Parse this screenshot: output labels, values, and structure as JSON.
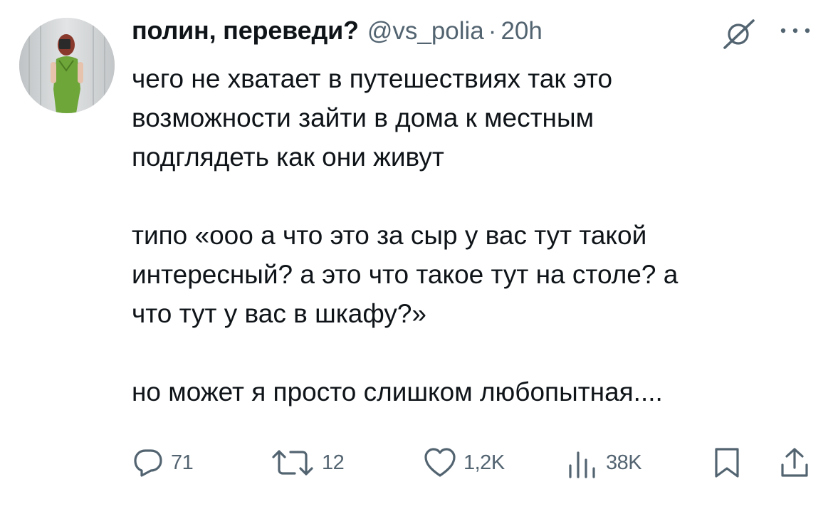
{
  "tweet": {
    "display_name": "полин, переведи?",
    "handle": "@vs_polia",
    "separator": "·",
    "time": "20h",
    "text": "чего не хватает в путешествиях так это\nвозможности зайти в дома к местным\nподглядеть как они живут\n\nтипо «ооо а что это за сыр у вас тут такой\nинтересный? а это что такое тут на столе? а\nчто тут у вас в шкафу?»\n\nно может я просто слишком любопытная...."
  },
  "actions": {
    "replies": "71",
    "retweets": "12",
    "likes": "1,2K",
    "views": "38K"
  },
  "icons": {
    "reply": "reply-icon",
    "retweet": "retweet-icon",
    "like": "heart-icon",
    "views": "views-chart-icon",
    "bookmark": "bookmark-icon",
    "share": "share-icon",
    "grok": "grok-icon",
    "more": "more-icon"
  },
  "colors": {
    "text": "#0f1419",
    "secondary": "#536471"
  }
}
